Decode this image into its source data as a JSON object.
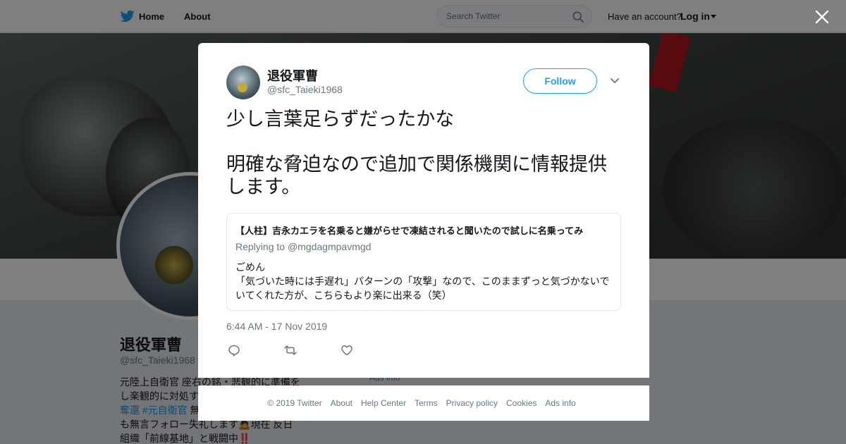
{
  "nav": {
    "home_label": "Home",
    "about_label": "About",
    "search_placeholder": "Search Twitter",
    "have_account": "Have an account?",
    "login_label": "Log in"
  },
  "profile": {
    "name": "退役軍曹",
    "handle": "@sfc_Taieki1968",
    "bio_lines": [
      "元陸上自衛官 座右の銘・悲観的に準備を",
      "し楽観的に対処す",
      "奪還 #元自衛官 無",
      "も無言フォロー失礼します",
      "組織「前線基地」と戦闘中"
    ],
    "bio_emoji_1": "🙇",
    "bio_after_emoji": "現在 反日",
    "bio_emoji_2": "‼️",
    "hashtag": "#元自衛官",
    "hashtag_prefix": "奪還",
    "hashtag_suffix": "無",
    "ads_info": "Ads info"
  },
  "tweet": {
    "author_name": "退役軍曹",
    "author_handle": "@sfc_Taieki1968",
    "follow_label": "Follow",
    "text_lines": [
      "少し言葉足らずだったかな",
      "",
      "明確な脅迫なので追加で関係機関に情報提供",
      "します。"
    ],
    "timestamp": "6:44 AM - 17 Nov 2019",
    "quote": {
      "title": "【人柱】吉永カエラを名乗ると嫌がらせで凍結されると聞いたので試しに名乗ってみ",
      "replying_prefix": "Replying to ",
      "replying_handle": "@mgdagmpavmgd",
      "body_lines": [
        "ごめん",
        "「気づいた時には手遅れ」パターンの「攻撃」なので、このままずっと気づかないで",
        "いてくれた方が、こちらもより楽に出来る（笑）"
      ]
    }
  },
  "footer": {
    "copyright": "© 2019 Twitter",
    "links": [
      "About",
      "Help Center",
      "Terms",
      "Privacy policy",
      "Cookies",
      "Ads info"
    ]
  },
  "colors": {
    "twitter_blue": "#1da1f2",
    "text_primary": "#14171a",
    "text_secondary": "#657786",
    "overlay": "rgba(0,0,0,0.5)"
  },
  "icons": {
    "nav_logo": "twitter-bird-icon",
    "search": "search-icon",
    "close": "close-icon",
    "more": "chevron-down-icon",
    "reply": "reply-icon",
    "retweet": "retweet-icon",
    "like": "heart-icon"
  }
}
